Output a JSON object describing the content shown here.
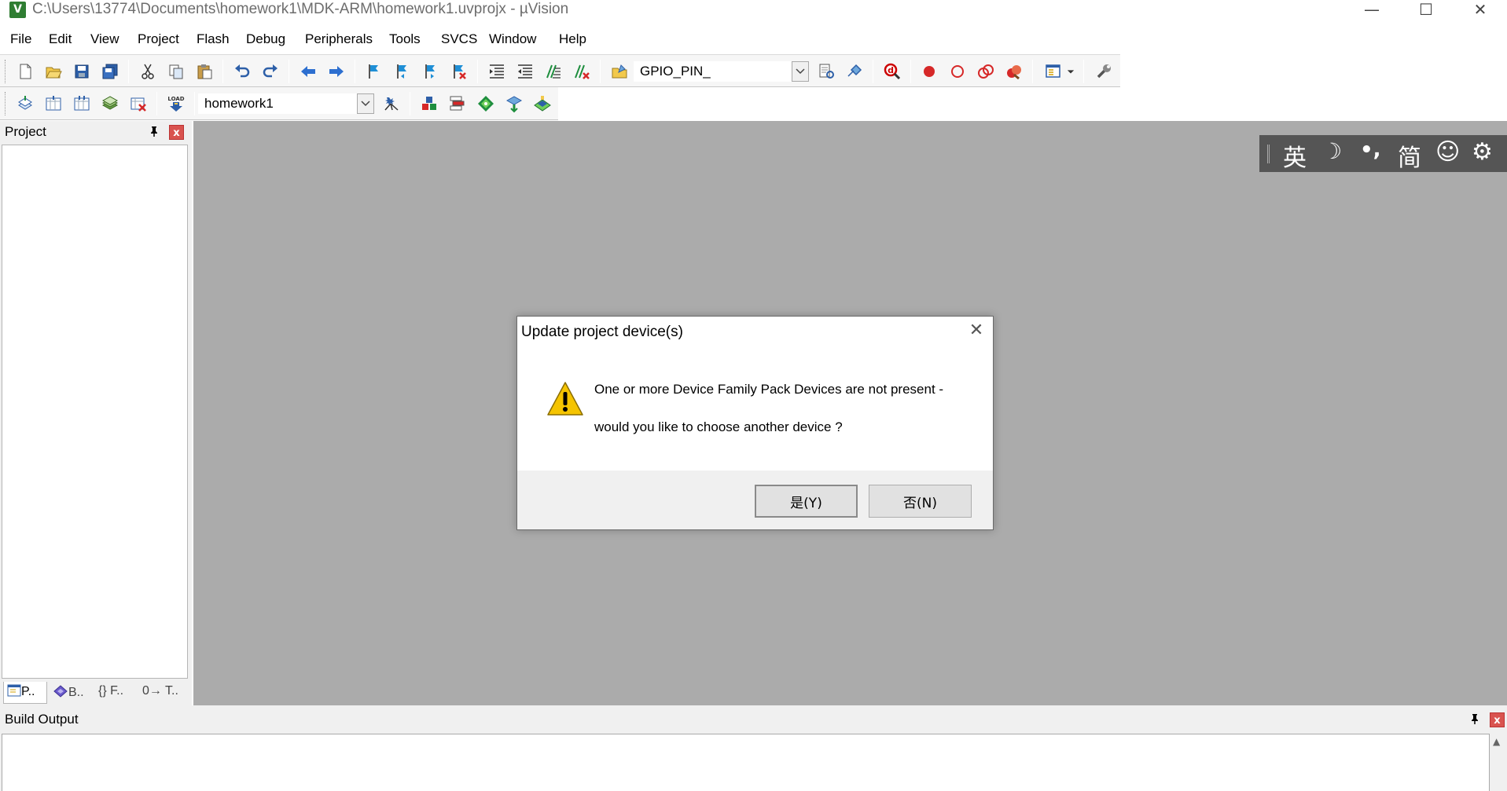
{
  "window": {
    "title": "C:\\Users\\13774\\Documents\\homework1\\MDK-ARM\\homework1.uvprojx - µVision",
    "app_icon": "V",
    "controls": {
      "minimize": "—",
      "maximize": "☐",
      "close": "✕"
    }
  },
  "menu": [
    "File",
    "Edit",
    "View",
    "Project",
    "Flash",
    "Debug",
    "Peripherals",
    "Tools",
    "SVCS",
    "Window",
    "Help"
  ],
  "toolbar1": {
    "search_combo_value": "GPIO_PIN_"
  },
  "toolbar2": {
    "target_combo_value": "homework1"
  },
  "project_panel": {
    "title": "Project",
    "pin": "📌",
    "close": "x",
    "tabs": [
      "P..",
      "B..",
      "{} F..",
      "0→ T.."
    ]
  },
  "ime_bar": {
    "items": [
      "英",
      "☽",
      "•,",
      "简",
      "☺",
      "⚙"
    ]
  },
  "build_output": {
    "title": "Build Output"
  },
  "dialog": {
    "title": "Update project device(s)",
    "close": "✕",
    "message_line1": "One or more Device Family Pack Devices are not present -",
    "message_line2": "would you like to choose another device ?",
    "yes_button": "是(Y)",
    "no_button": "否(N)"
  },
  "colors": {
    "workspace": "#ababab",
    "ime_bar": "#555555",
    "warning_yellow": "#f5c400",
    "close_red": "#d9534f"
  }
}
